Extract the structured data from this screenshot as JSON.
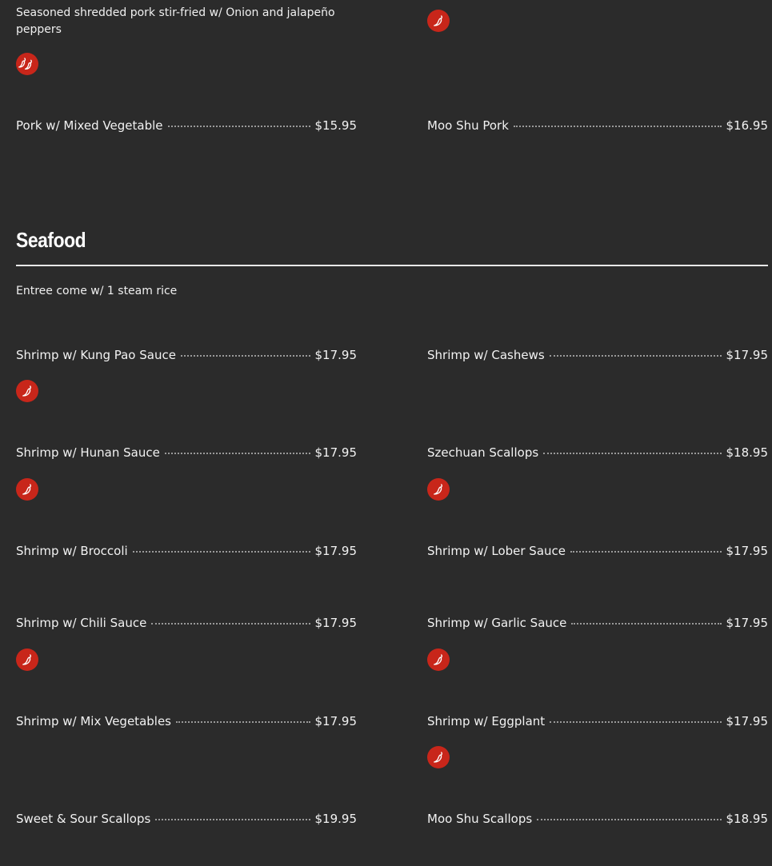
{
  "top": {
    "left_description": "Seasoned shredded pork stir-fried w/ Onion and jalapeño peppers",
    "pork_mixed": {
      "name": "Pork w/ Mixed Vegetable",
      "price": "$15.95"
    },
    "moo_shu_pork": {
      "name": "Moo Shu Pork",
      "price": "$16.95"
    }
  },
  "seafood": {
    "title": "Seafood",
    "note": "Entree come w/ 1 steam rice",
    "items": [
      {
        "name": "Shrimp w/ Kung Pao Sauce",
        "price": "$17.95",
        "spicy": true
      },
      {
        "name": "Shrimp w/ Cashews",
        "price": "$17.95",
        "spicy": false
      },
      {
        "name": "Shrimp w/ Hunan Sauce",
        "price": "$17.95",
        "spicy": true
      },
      {
        "name": "Szechuan Scallops",
        "price": "$18.95",
        "spicy": true
      },
      {
        "name": "Shrimp w/ Broccoli",
        "price": "$17.95",
        "spicy": false
      },
      {
        "name": "Shrimp w/ Lober Sauce",
        "price": "$17.95",
        "spicy": false
      },
      {
        "name": "Shrimp w/ Chili Sauce",
        "price": "$17.95",
        "spicy": true
      },
      {
        "name": "Shrimp w/ Garlic Sauce",
        "price": "$17.95",
        "spicy": true
      },
      {
        "name": "Shrimp w/ Mix Vegetables",
        "price": "$17.95",
        "spicy": false
      },
      {
        "name": "Shrimp w/ Eggplant",
        "price": "$17.95",
        "spicy": true
      },
      {
        "name": "Sweet & Sour Scallops",
        "price": "$19.95",
        "spicy": false
      },
      {
        "name": "Moo Shu Scallops",
        "price": "$18.95",
        "spicy": false
      }
    ]
  },
  "icons": {
    "spicy": "chili-pepper-icon",
    "extra_spicy": "double-chili-pepper-icon"
  },
  "colors": {
    "background": "#2b2b2b",
    "spicy_badge": "#c8261a",
    "text": "#f2f2f2"
  }
}
